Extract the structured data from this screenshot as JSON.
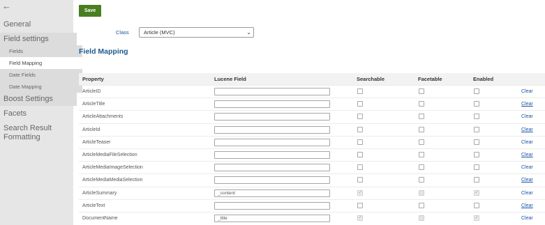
{
  "sidebar": {
    "back_icon": "←",
    "items": [
      {
        "label": "General"
      },
      {
        "label": "Field settings"
      },
      {
        "label": "Fields"
      },
      {
        "label": "Field Mapping"
      },
      {
        "label": "Date Fields"
      },
      {
        "label": "Date Mapping"
      },
      {
        "label": "Boost Settings"
      },
      {
        "label": "Facets"
      },
      {
        "label": "Search Result Formatting"
      }
    ]
  },
  "toolbar": {
    "save_label": "Save"
  },
  "class_selector": {
    "label": "Class",
    "value": "Article (MVC)"
  },
  "section_title": "Field Mapping",
  "table": {
    "headers": {
      "property": "Property",
      "lucene": "Lucene Field",
      "searchable": "Searchable",
      "facetable": "Facetable",
      "enabled": "Enabled"
    },
    "rows": [
      {
        "property": "ArticleID",
        "lucene": "",
        "searchable": false,
        "facetable": false,
        "enabled": false,
        "clear": "Clear"
      },
      {
        "property": "ArticleTitle",
        "lucene": "",
        "searchable": false,
        "facetable": false,
        "enabled": false,
        "clear": "Clear"
      },
      {
        "property": "ArticleAttachments",
        "lucene": "",
        "searchable": false,
        "facetable": false,
        "enabled": false,
        "clear": "Clear"
      },
      {
        "property": "ArticleId",
        "lucene": "",
        "searchable": false,
        "facetable": false,
        "enabled": false,
        "clear": "Clear"
      },
      {
        "property": "ArticleTeaser",
        "lucene": "",
        "searchable": false,
        "facetable": false,
        "enabled": false,
        "clear": "Clear"
      },
      {
        "property": "ArticleMediaFileSelection",
        "lucene": "",
        "searchable": false,
        "facetable": false,
        "enabled": false,
        "clear": "Clear"
      },
      {
        "property": "ArticleMediaImageSelection",
        "lucene": "",
        "searchable": false,
        "facetable": false,
        "enabled": false,
        "clear": "Clear"
      },
      {
        "property": "ArticleMediaMediaSelection",
        "lucene": "",
        "searchable": false,
        "facetable": false,
        "enabled": false,
        "clear": "Clear"
      },
      {
        "property": "ArticleSummary",
        "lucene": "_content",
        "searchable": true,
        "facetable": false,
        "enabled": true,
        "clear": "Clear"
      },
      {
        "property": "ArticleText",
        "lucene": "",
        "searchable": false,
        "facetable": false,
        "enabled": false,
        "clear": "Clear"
      },
      {
        "property": "DocumentName",
        "lucene": "_title",
        "searchable": true,
        "facetable": false,
        "enabled": true,
        "clear": "Clear"
      }
    ]
  },
  "colors": {
    "save_button": "#497f1f",
    "link": "#1a53a6",
    "section_title": "#1c5a8c",
    "sidebar_bg": "#e6e6e6"
  }
}
